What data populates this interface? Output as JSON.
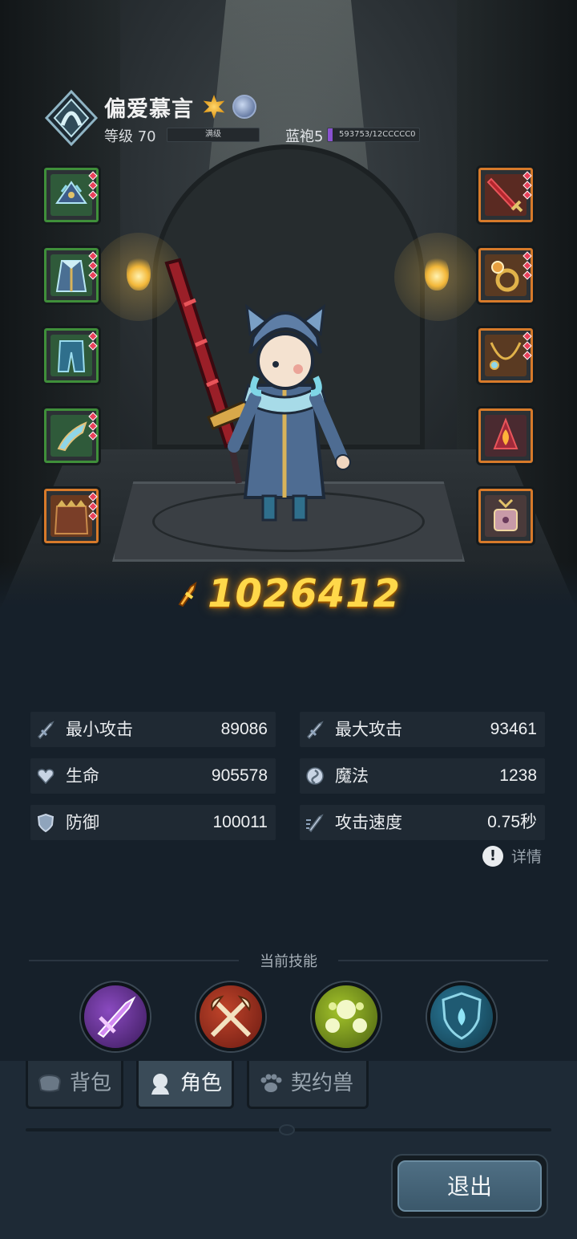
{
  "header": {
    "player_name": "偏爱慕言",
    "level_label": "等级 70",
    "level_bar_text": "满级",
    "rank_label": "蓝袍5",
    "rank_progress_text": "593753/12CCCCC0",
    "rank_progress": 0.05,
    "badges": [
      "sun-badge-icon",
      "moon-badge-icon"
    ]
  },
  "equipment": {
    "left": [
      {
        "name": "helmet-icon",
        "rarity": "green"
      },
      {
        "name": "robe-icon",
        "rarity": "green"
      },
      {
        "name": "pants-icon",
        "rarity": "green"
      },
      {
        "name": "boots-icon",
        "rarity": "green"
      },
      {
        "name": "cape-icon",
        "rarity": "orange"
      }
    ],
    "right": [
      {
        "name": "sword-icon",
        "rarity": "orange"
      },
      {
        "name": "ring-icon",
        "rarity": "orange"
      },
      {
        "name": "necklace-icon",
        "rarity": "orange"
      },
      {
        "name": "flame-gem-icon",
        "rarity": "orange"
      },
      {
        "name": "relic-box-icon",
        "rarity": "orange"
      }
    ]
  },
  "combat_power": "1026412",
  "stats": [
    {
      "label": "最小攻击",
      "value": "89086",
      "icon": "sword-attack-icon"
    },
    {
      "label": "最大攻击",
      "value": "93461",
      "icon": "sword-attack-icon"
    },
    {
      "label": "生命",
      "value": "905578",
      "icon": "heart-icon"
    },
    {
      "label": "魔法",
      "value": "1238",
      "icon": "magic-swirl-icon"
    },
    {
      "label": "防御",
      "value": "100011",
      "icon": "shield-icon"
    },
    {
      "label": "攻击速度",
      "value": "0.75秒",
      "icon": "speed-icon"
    }
  ],
  "details_label": "详情",
  "skills_title": "当前技能",
  "skills": [
    {
      "name": "purple-strike-skill-icon"
    },
    {
      "name": "crossed-axes-skill-icon"
    },
    {
      "name": "green-orbs-skill-icon"
    },
    {
      "name": "water-shield-skill-icon"
    }
  ],
  "tabs": [
    {
      "label": "背包",
      "icon": "bag-icon",
      "active": false
    },
    {
      "label": "角色",
      "icon": "character-icon",
      "active": true
    },
    {
      "label": "契约兽",
      "icon": "paw-icon",
      "active": false
    }
  ],
  "exit_label": "退出",
  "colors": {
    "green_rarity": "#3f8f3a",
    "orange_rarity": "#d77a2a",
    "power_gold": "#ffd84a",
    "rank_purple": "#8a52d0"
  }
}
